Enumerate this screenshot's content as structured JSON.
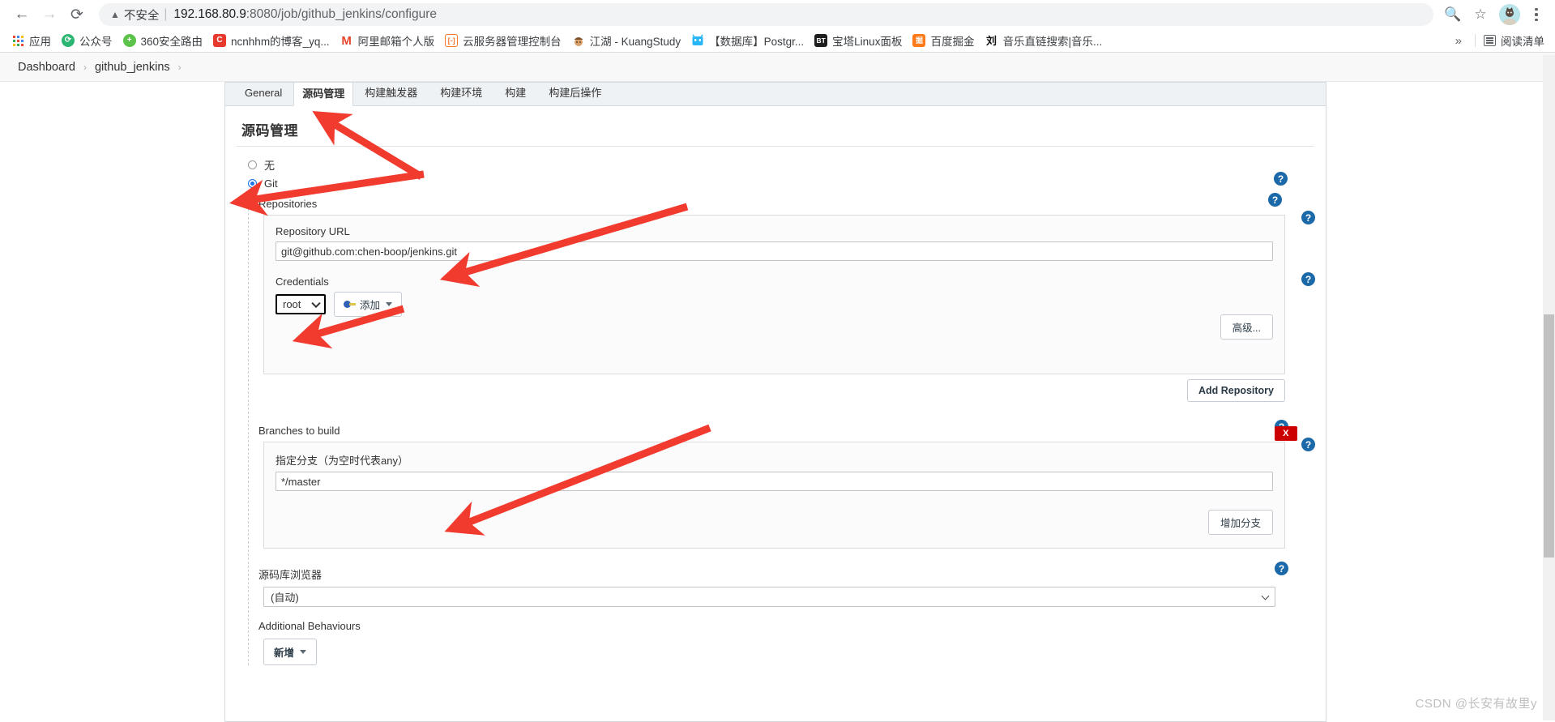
{
  "browser": {
    "back_icon": "back-arrow-icon",
    "forward_icon": "forward-arrow-icon",
    "reload_icon": "reload-icon",
    "security_label": "不安全",
    "url_host": "192.168.80.9",
    "url_rest": ":8080/job/github_jenkins/configure",
    "zoom_out_icon": "zoom-out-icon",
    "bookmark_star_icon": "star-icon",
    "profile_icon": "avatar-icon",
    "menu_icon": "kebab-menu-icon",
    "bookmarks": [
      {
        "label": "应用",
        "icon": "apps-grid-icon",
        "color": "#4285f4",
        "glyph": ""
      },
      {
        "label": "公众号",
        "icon": "wechat-icon",
        "color": "#2bb673",
        "glyph": "S"
      },
      {
        "label": "360安全路由",
        "icon": "360-icon",
        "color": "#5bc34a",
        "glyph": "+"
      },
      {
        "label": "ncnhhm的博客_yq...",
        "icon": "csdn-icon",
        "color": "#e63a2e",
        "glyph": "C"
      },
      {
        "label": "阿里邮箱个人版",
        "icon": "mail-icon",
        "color": "#e8452c",
        "glyph": "M"
      },
      {
        "label": "云服务器管理控制台",
        "icon": "cloud-console-icon",
        "color": "#f5792a",
        "glyph": "[-]"
      },
      {
        "label": "江湖 - KuangStudy",
        "icon": "kuangstudy-icon",
        "color": "#8d6e4e",
        "glyph": "K"
      },
      {
        "label": "【数据库】Postgr...",
        "icon": "database-icon",
        "color": "#29b6f6",
        "glyph": "H"
      },
      {
        "label": "宝塔Linux面板",
        "icon": "bt-panel-icon",
        "color": "#1f1f1f",
        "glyph": "BT"
      },
      {
        "label": "百度掘金",
        "icon": "juejin-icon",
        "color": "#ff7a1a",
        "glyph": "掘"
      },
      {
        "label": "音乐直链搜索|音乐...",
        "icon": "music-icon",
        "color": "#ffffff",
        "glyph": "刘"
      }
    ],
    "overflow_label": "»",
    "reading_list_label": "阅读清单",
    "reading_list_icon": "reading-list-icon"
  },
  "jenkins": {
    "breadcrumb": [
      "Dashboard",
      "github_jenkins"
    ],
    "breadcrumb_sep": "›",
    "tabs": [
      {
        "label": "General",
        "active": false
      },
      {
        "label": "源码管理",
        "active": true
      },
      {
        "label": "构建触发器",
        "active": false
      },
      {
        "label": "构建环境",
        "active": false
      },
      {
        "label": "构建",
        "active": false
      },
      {
        "label": "构建后操作",
        "active": false
      }
    ],
    "section_title": "源码管理",
    "scm_options": [
      {
        "label": "无",
        "checked": false
      },
      {
        "label": "Git",
        "checked": true
      }
    ],
    "repositories": {
      "group_label": "Repositories",
      "url_label": "Repository URL",
      "url_value": "git@github.com:chen-boop/jenkins.git",
      "credentials_label": "Credentials",
      "credentials_value": "root",
      "add_button": "添加",
      "advanced_button": "高级...",
      "add_repo_button": "Add Repository"
    },
    "branches": {
      "group_label": "Branches to build",
      "branch_label": "指定分支（为空时代表any）",
      "branch_value": "*/master",
      "add_branch_button": "增加分支",
      "delete_badge": "X"
    },
    "browser_section": {
      "label": "源码库浏览器",
      "value": "(自动)"
    },
    "additional": {
      "label": "Additional Behaviours",
      "add_button": "新增"
    },
    "help_icon_glyph": "?"
  },
  "watermark": "CSDN @长安有故里y"
}
